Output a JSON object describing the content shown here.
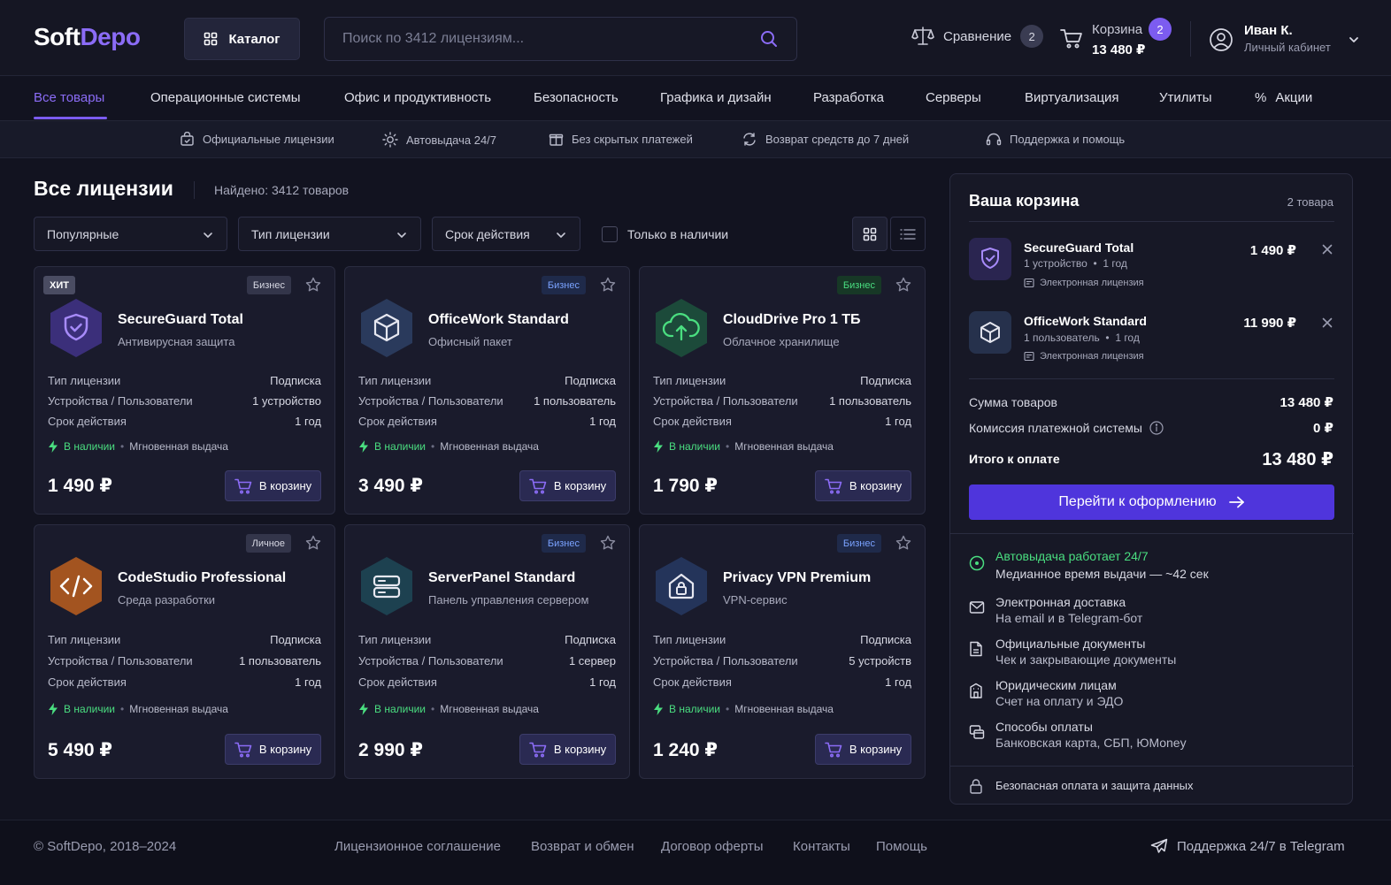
{
  "header": {
    "logo_a": "Soft",
    "logo_b": "Depo",
    "catalog_label": "Каталог",
    "search_placeholder": "Поиск по 3412 лицензиям...",
    "compare_label": "Сравнение",
    "compare_count": "2",
    "cart_label": "Корзина",
    "cart_total": "13 480 ₽",
    "cart_count": "2",
    "user_name": "Иван К.",
    "user_sub": "Личный кабинет"
  },
  "nav": [
    "Все товары",
    "Операционные системы",
    "Офис и продуктивность",
    "Безопасность",
    "Графика и дизайн",
    "Разработка",
    "Серверы",
    "Виртуализация",
    "Утилиты",
    "Акции"
  ],
  "features": [
    "Официальные лицензии",
    "Автовыдача 24/7",
    "Без скрытых платежей",
    "Возврат средств до 7 дней",
    "Поддержка и помощь"
  ],
  "listing": {
    "title": "Все лицензии",
    "found": "Найдено: 3412 товаров",
    "sort": "Популярные",
    "filter_type": "Тип лицензии",
    "filter_term": "Срок действия",
    "only_stock": "Только в наличии"
  },
  "card_labels": {
    "type": "Тип лицензии",
    "devices": "Устройства / Пользователи",
    "term": "Срок действия",
    "in_stock": "В наличии",
    "instant": "Мгновенная выдача",
    "add": "В корзину"
  },
  "products": [
    {
      "tag": "Бизнес",
      "hit": "ХИТ",
      "name": "SecureGuard Total",
      "sub": "Антивирусная защита",
      "type": "Подписка",
      "devices": "1 устройство",
      "term": "1 год",
      "price": "1 490 ₽"
    },
    {
      "tag": "Бизнес",
      "name": "OfficeWork Standard",
      "sub": "Офисный пакет",
      "type": "Подписка",
      "devices": "1 пользователь",
      "term": "1 год",
      "price": "3 490 ₽"
    },
    {
      "tag": "Бизнес",
      "name": "CloudDrive Pro 1 ТБ",
      "sub": "Облачное хранилище",
      "type": "Подписка",
      "devices": "1 пользователь",
      "term": "1 год",
      "price": "1 790 ₽"
    },
    {
      "tag": "Личное",
      "name": "CodeStudio Professional",
      "sub": "Среда разработки",
      "type": "Подписка",
      "devices": "1 пользователь",
      "term": "1 год",
      "price": "5 490 ₽"
    },
    {
      "tag": "Бизнес",
      "name": "ServerPanel Standard",
      "sub": "Панель управления сервером",
      "type": "Подписка",
      "devices": "1 сервер",
      "term": "1 год",
      "price": "2 990 ₽"
    },
    {
      "tag": "Бизнес",
      "name": "Privacy VPN Premium",
      "sub": "VPN-сервис",
      "type": "Подписка",
      "devices": "5 устройств",
      "term": "1 год",
      "price": "1 240 ₽"
    }
  ],
  "cart": {
    "title": "Ваша корзина",
    "count": "2 товара",
    "items": [
      {
        "name": "SecureGuard Total",
        "meta1": "1 устройство",
        "meta2": "1 год",
        "delivery": "Электронная лицензия",
        "price": "1 490 ₽"
      },
      {
        "name": "OfficeWork Standard",
        "meta1": "1 пользователь",
        "meta2": "1 год",
        "delivery": "Электронная лицензия",
        "price": "11 990 ₽"
      }
    ],
    "subtotal_label": "Сумма товаров",
    "subtotal": "13 480 ₽",
    "fee_label": "Комиссия платежной системы",
    "fee": "0 ₽",
    "total_label": "Итого к оплате",
    "total": "13 480 ₽",
    "checkout": "Перейти к оформлению",
    "info": [
      {
        "title": "Автовыдача работает 24/7",
        "sub": "Медианное время выдачи — ~42 сек"
      },
      {
        "title": "Электронная доставка",
        "sub": "На email и в Telegram-бот"
      },
      {
        "title": "Официальные документы",
        "sub": "Чек и закрывающие документы"
      },
      {
        "title": "Юридическим лицам",
        "sub": "Счет на оплату и ЭДО"
      },
      {
        "title": "Способы оплаты",
        "sub": "Банковская карта, СБП, ЮMoney"
      }
    ],
    "secure": "Безопасная оплата и защита данных"
  },
  "footer": {
    "copy": "© SoftDepo, 2018–2024",
    "links": [
      "Лицензионное соглашение",
      "Возврат и обмен",
      "Договор оферты",
      "Контакты",
      "Помощь"
    ],
    "telegram": "Поддержка 24/7 в Telegram"
  },
  "colors": {
    "accent": "#7c5cf0",
    "checkout": "#4f35dc",
    "success": "#4ade80",
    "background": "#121320",
    "card": "#1a1b2c"
  }
}
